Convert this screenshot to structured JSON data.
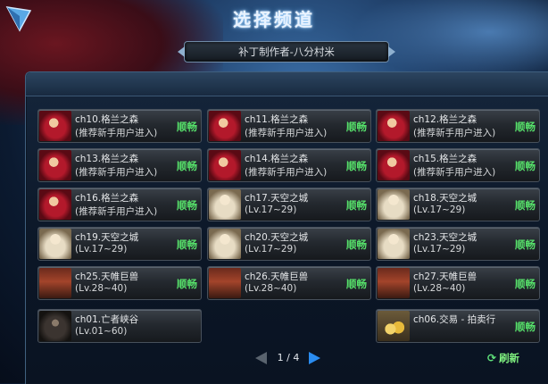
{
  "header": {
    "title": "选择频道",
    "banner": "补丁制作者-八分村米"
  },
  "cards": [
    {
      "name": "ch10.格兰之森",
      "sub": "(推荐新手用户进入)",
      "status": "顺畅",
      "avatar": "red-warrior-avatar"
    },
    {
      "name": "ch11.格兰之森",
      "sub": "(推荐新手用户进入)",
      "status": "顺畅",
      "avatar": "red-warrior-avatar"
    },
    {
      "name": "ch12.格兰之森",
      "sub": "(推荐新手用户进入)",
      "status": "顺畅",
      "avatar": "red-warrior-avatar"
    },
    {
      "name": "ch13.格兰之森",
      "sub": "(推荐新手用户进入)",
      "status": "顺畅",
      "avatar": "red-warrior-avatar"
    },
    {
      "name": "ch14.格兰之森",
      "sub": "(推荐新手用户进入)",
      "status": "顺畅",
      "avatar": "red-warrior-avatar"
    },
    {
      "name": "ch15.格兰之森",
      "sub": "(推荐新手用户进入)",
      "status": "顺畅",
      "avatar": "red-warrior-avatar"
    },
    {
      "name": "ch16.格兰之森",
      "sub": "(推荐新手用户进入)",
      "status": "顺畅",
      "avatar": "red-warrior-avatar"
    },
    {
      "name": "ch17.天空之城",
      "sub": "(Lv.17~29)",
      "status": "顺畅",
      "avatar": "white-knight-avatar"
    },
    {
      "name": "ch18.天空之城",
      "sub": "(Lv.17~29)",
      "status": "顺畅",
      "avatar": "white-knight-avatar"
    },
    {
      "name": "ch19.天空之城",
      "sub": "(Lv.17~29)",
      "status": "顺畅",
      "avatar": "white-knight-avatar"
    },
    {
      "name": "ch20.天空之城",
      "sub": "(Lv.17~29)",
      "status": "顺畅",
      "avatar": "white-knight-avatar"
    },
    {
      "name": "ch23.天空之城",
      "sub": "(Lv.17~29)",
      "status": "顺畅",
      "avatar": "white-knight-avatar"
    },
    {
      "name": "ch25.天帷巨兽",
      "sub": "(Lv.28~40)",
      "status": "顺畅",
      "avatar": "ship-deck-avatar"
    },
    {
      "name": "ch26.天帷巨兽",
      "sub": "(Lv.28~40)",
      "status": "顺畅",
      "avatar": "ship-deck-avatar"
    },
    {
      "name": "ch27.天帷巨兽",
      "sub": "(Lv.28~40)",
      "status": "顺畅",
      "avatar": "ship-deck-avatar"
    },
    {
      "name": "ch01.亡者峡谷",
      "sub": "(Lv.01~60)",
      "status": "",
      "avatar": "hooded-figure-avatar"
    },
    {
      "name": "ch06.交易 - 拍卖行",
      "sub": "",
      "status": "顺畅",
      "avatar": "gold-coins-avatar"
    }
  ],
  "pager": {
    "text": "1 / 4"
  },
  "refresh": {
    "label": "刷新"
  },
  "colors": {
    "status": "#56e06a",
    "next_arrow": "#2a8cf0"
  }
}
